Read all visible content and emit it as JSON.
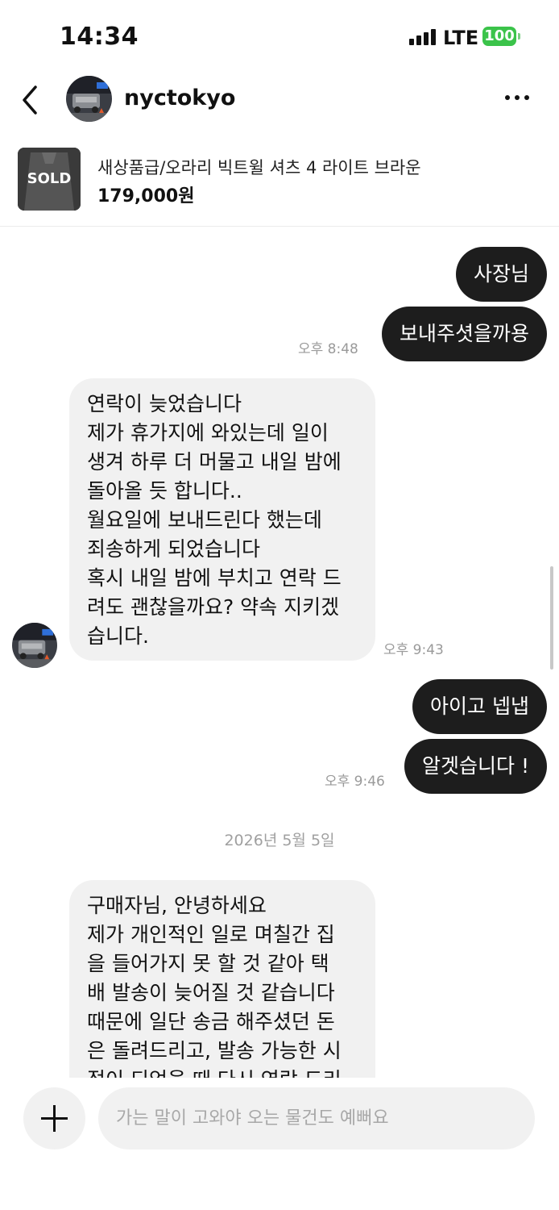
{
  "status_bar": {
    "time": "14:34",
    "network": "LTE",
    "battery": "100"
  },
  "header": {
    "username": "nyctokyo"
  },
  "product": {
    "sold_label": "SOLD",
    "title": "새상품급/오라리 빅트윌 셔츠 4 라이트 브라운",
    "price": "179,000원"
  },
  "messages": [
    {
      "type": "sent",
      "text": "사장님"
    },
    {
      "type": "sent",
      "text": "보내주셧을까용",
      "time": "오후 8:48"
    },
    {
      "type": "received",
      "text": "연락이 늦었습니다\n제가 휴가지에 와있는데 일이\n생겨 하루 더 머물고 내일 밤에\n돌아올 듯 합니다..\n월요일에 보내드린다 했는데\n죄송하게 되었습니다\n혹시 내일 밤에 부치고 연락 드\n려도 괜찮을까요? 약속 지키겠\n습니다.",
      "time": "오후 9:43"
    },
    {
      "type": "sent",
      "text": "아이고 넵냅"
    },
    {
      "type": "sent",
      "text": "알겟습니다 !",
      "time": "오후 9:46"
    },
    {
      "type": "date_separator",
      "text": "2026년 5월 5일"
    },
    {
      "type": "received",
      "text": "구매자님, 안녕하세요\n제가 개인적인 일로 며칠간 집\n을 들어가지 못 할 것 같아 택\n배 발송이 늦어질 것 같습니다\n때문에 일단 송금 해주셨던 돈\n은 돌려드리고, 발송 가능한 시\n점이 되었을 때 다시 연락 드리"
    }
  ],
  "composer": {
    "placeholder": "가는 말이 고와야 오는 물건도 예뻐요"
  },
  "icons": [
    "back-arrow-icon",
    "more-icon",
    "plus-icon",
    "signal-icon",
    "battery-icon"
  ]
}
